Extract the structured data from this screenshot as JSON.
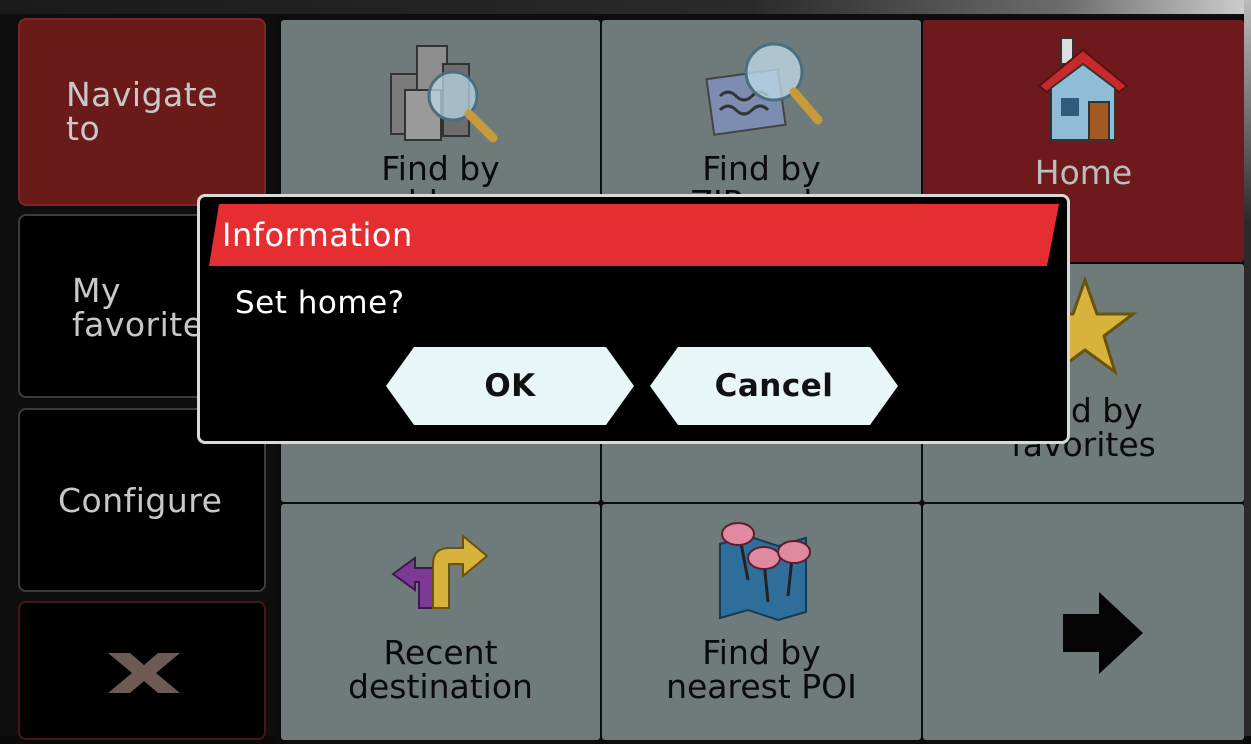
{
  "sidebar": {
    "navigate_label": "Navigate\nto",
    "favorites_label": "My\nfavorites",
    "configure_label": "Configure"
  },
  "tiles": {
    "find_by_address": "Find by\naddress",
    "find_by_zip": "Find by\nZIP code",
    "home": "Home",
    "find_by_favorites": "Find by\nfavorites",
    "recent_destination": "Recent\ndestination",
    "find_by_nearest_poi": "Find by\nnearest POI"
  },
  "dialog": {
    "title": "Information",
    "message": "Set home?",
    "ok_label": "OK",
    "cancel_label": "Cancel"
  },
  "colors": {
    "accent_red": "#e42e32",
    "active_tile": "#6e1a1c",
    "tile_gray": "#6f7b7a",
    "dialog_button": "#e8f6f7"
  }
}
